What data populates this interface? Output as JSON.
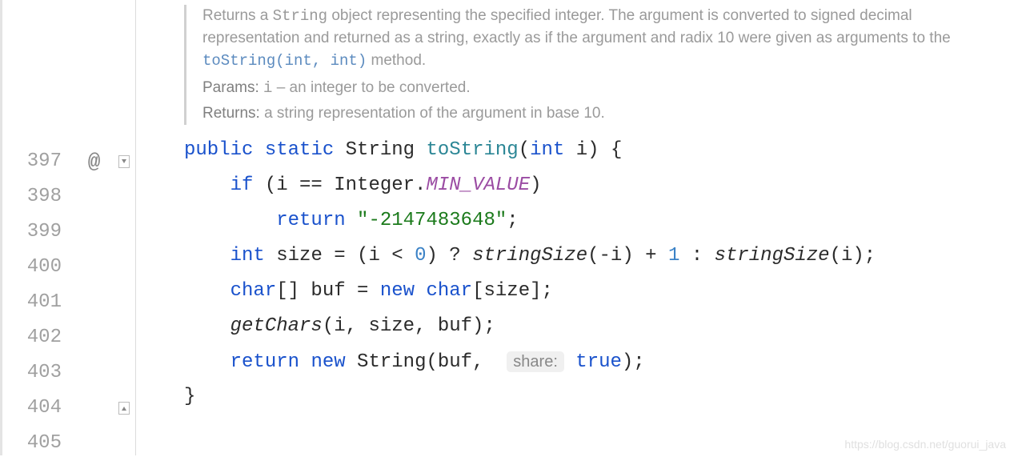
{
  "gutter": {
    "lineNumbers": [
      "397",
      "398",
      "399",
      "400",
      "401",
      "402",
      "403",
      "404",
      "405"
    ],
    "annotations": {
      "line397": "@"
    }
  },
  "javadoc": {
    "description_pre": "Returns a ",
    "code1": "String",
    "description_mid": " object representing the specified integer. The argument is converted to signed decimal representation and returned as a string, exactly as if the argument and radix 10 were given as arguments to the ",
    "link1": "toString(int, int)",
    "description_post": " method.",
    "params_label": "Params:",
    "params_name": "i",
    "params_desc": " – an integer to be converted.",
    "returns_label": "Returns:",
    "returns_desc": " a string representation of the argument in base 10."
  },
  "code": {
    "l397": {
      "public": "public",
      "static": "static",
      "type": "String",
      "method": "toString",
      "params_open": "(",
      "int": "int",
      "param": " i) {"
    },
    "l398": {
      "if": "if",
      "cond1": " (i == Integer.",
      "const": "MIN_VALUE",
      "cond2": ")"
    },
    "l399": {
      "return": "return",
      "str": "\"-2147483648\"",
      "semi": ";"
    },
    "l400": {
      "int": "int",
      "size": " size = (i < ",
      "zero": "0",
      "q": ") ? ",
      "fn1": "stringSize",
      "mid": "(-i) + ",
      "one": "1",
      "colon": " : ",
      "fn2": "stringSize",
      "end": "(i);"
    },
    "l401": {
      "char": "char",
      "arr": "[] buf = ",
      "new": "new",
      "char2": " char",
      "end": "[size];"
    },
    "l402": {
      "fn": "getChars",
      "args": "(i, size, buf);"
    },
    "l403": {
      "return": "return",
      "new": "new",
      "type": " String(buf, ",
      "hint_label": "share:",
      "hint_val": "true",
      "end": ");"
    },
    "l404": "}"
  },
  "watermark": "https://blog.csdn.net/guorui_java"
}
